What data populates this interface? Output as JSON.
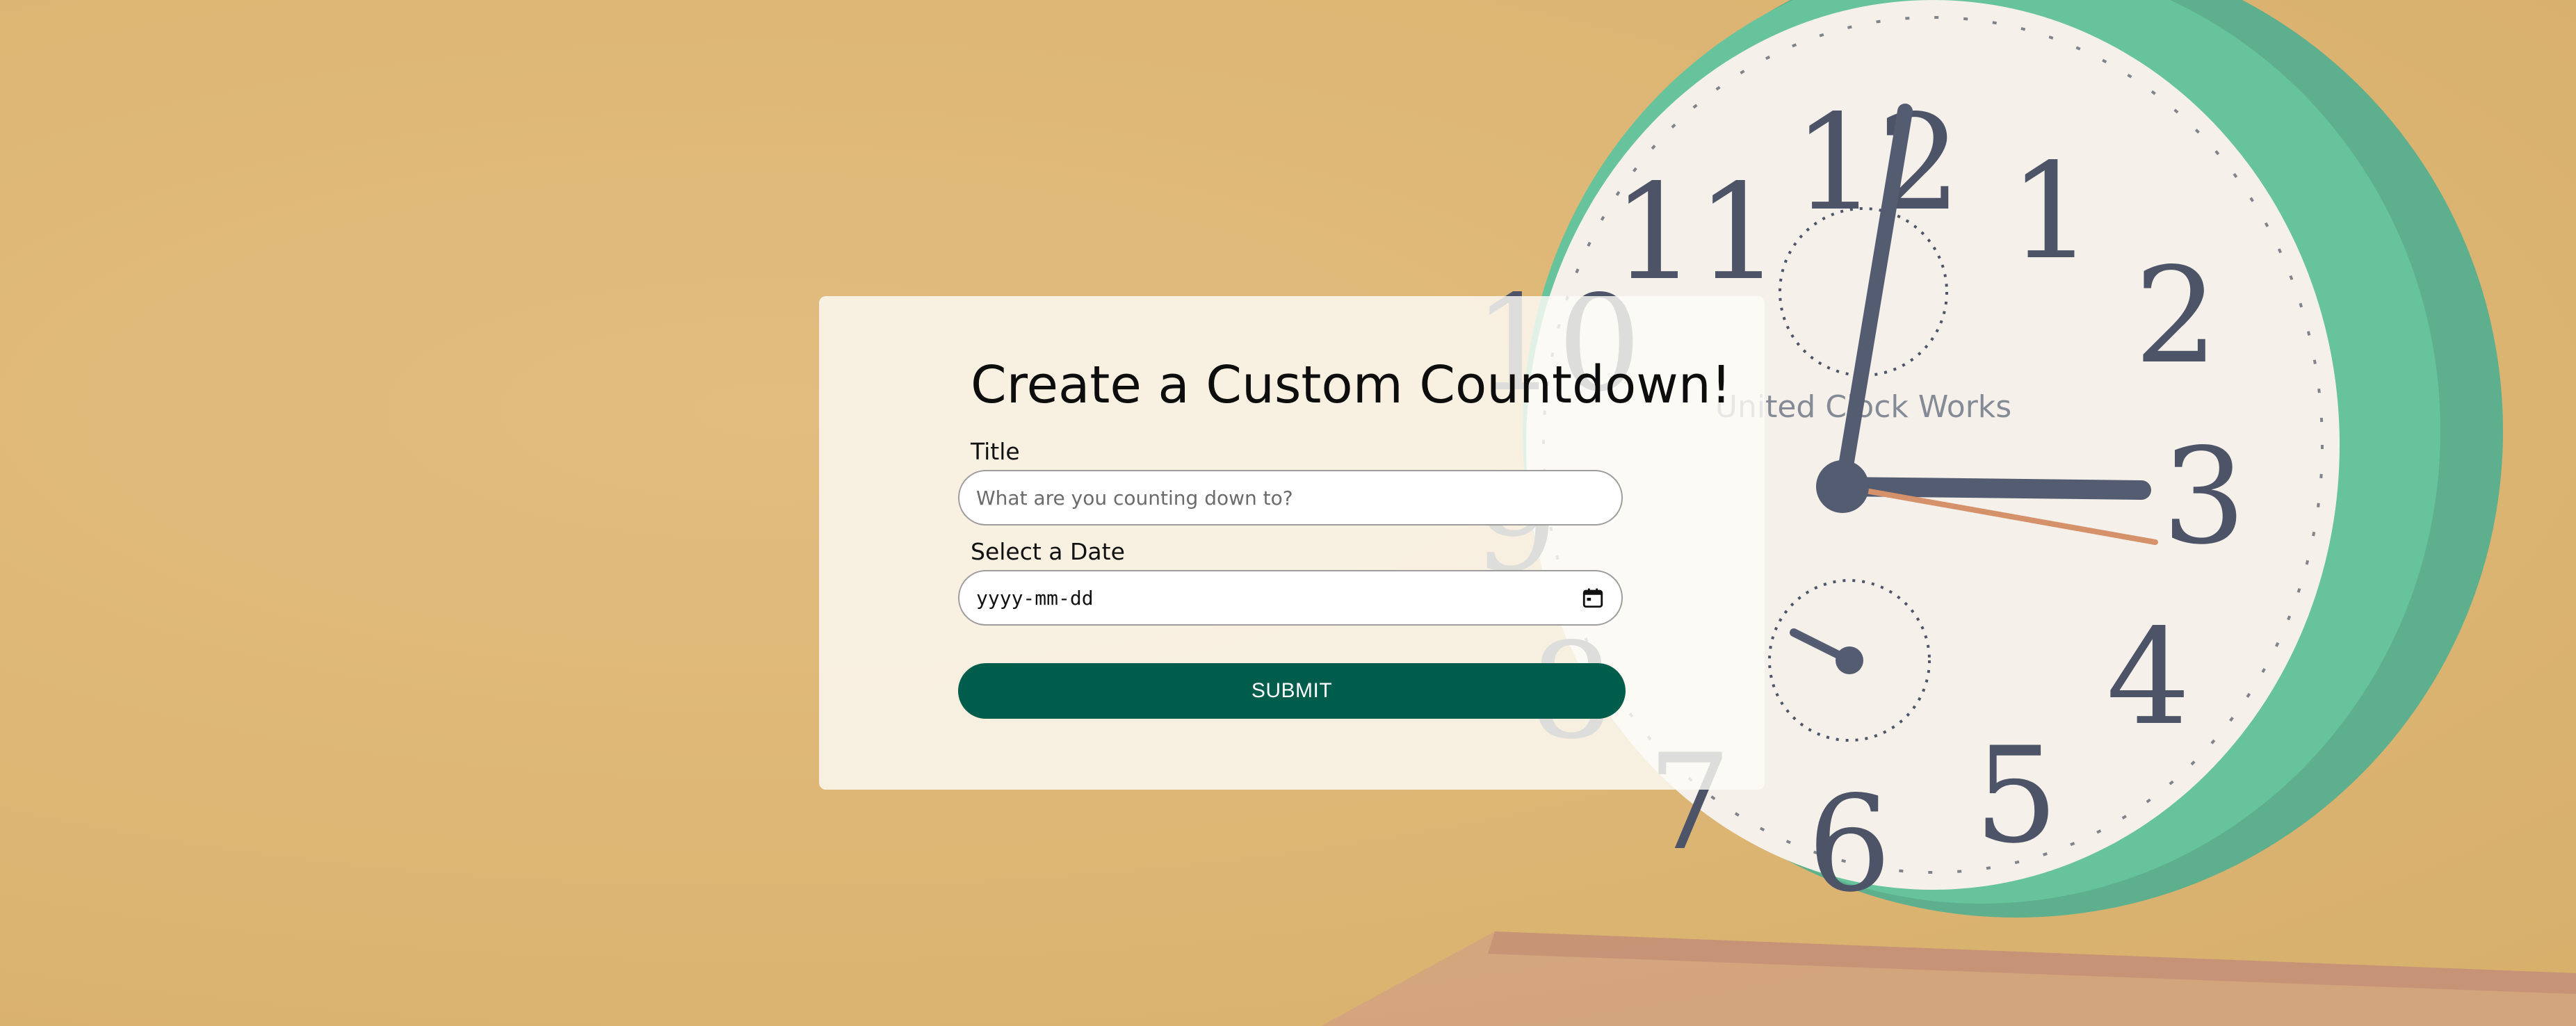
{
  "form": {
    "heading": "Create a Custom Countdown!",
    "title_label": "Title",
    "title_placeholder": "What are you counting down to?",
    "title_value": "",
    "date_label": "Select a Date",
    "date_placeholder": "yyyy-mm-dd",
    "submit_label": "SUBMIT"
  },
  "background": {
    "description_icon": "alarm-clock",
    "clock_brand": "United Clock Works",
    "dial_numbers": [
      "12",
      "1",
      "2",
      "3",
      "4",
      "5",
      "6",
      "7",
      "8",
      "9",
      "10",
      "11"
    ]
  },
  "colors": {
    "background": "#d7a95c",
    "card": "#fdfbf6",
    "accent": "#005c4b",
    "clock_body": "#3fae84"
  }
}
